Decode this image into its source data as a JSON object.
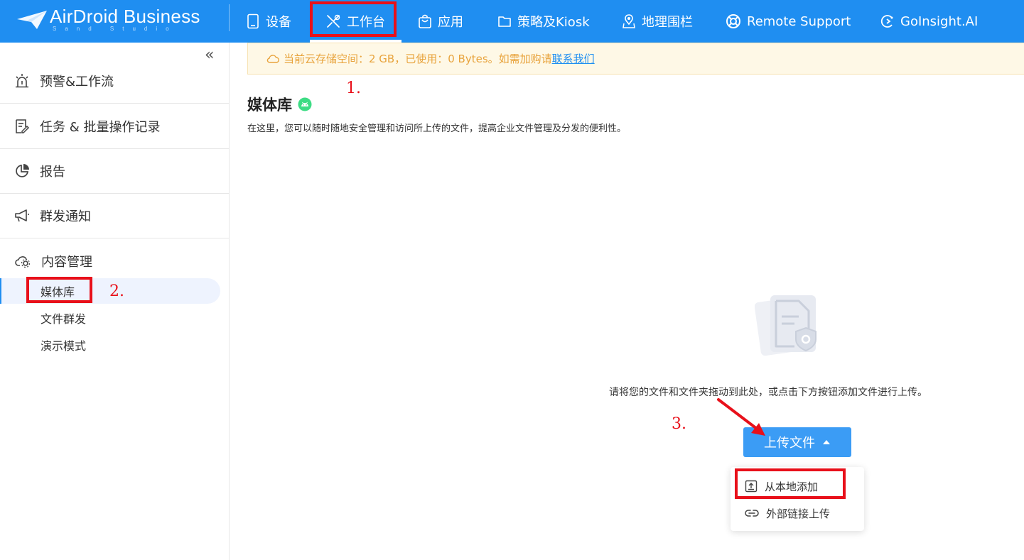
{
  "app": {
    "brand": "AirDroid Business",
    "brand_sub": "Sand Studio"
  },
  "nav": {
    "items": [
      {
        "label": "设备",
        "icon": "tablet-icon"
      },
      {
        "label": "工作台",
        "icon": "tools-icon",
        "active": true
      },
      {
        "label": "应用",
        "icon": "shopping-bag-icon"
      },
      {
        "label": "策略及Kiosk",
        "icon": "folder-icon"
      },
      {
        "label": "地理围栏",
        "icon": "map-pin-icon"
      },
      {
        "label": "Remote Support",
        "icon": "lifebuoy-icon"
      },
      {
        "label": "GoInsight.AI",
        "icon": "goinsight-icon"
      }
    ]
  },
  "sidebar": {
    "collapse_label": "«",
    "groups": [
      {
        "label": "预警&工作流",
        "icon": "alarm-icon"
      },
      {
        "label": "任务 & 批量操作记录",
        "icon": "task-list-icon"
      },
      {
        "label": "报告",
        "icon": "pie-chart-icon"
      },
      {
        "label": "群发通知",
        "icon": "megaphone-icon"
      },
      {
        "label": "内容管理",
        "icon": "cloud-settings-icon"
      }
    ],
    "sub_items": [
      {
        "label": "媒体库",
        "active": true
      },
      {
        "label": "文件群发"
      },
      {
        "label": "演示模式"
      }
    ]
  },
  "notice": {
    "text": "当前云存储空间：2 GB，已使用：0 Bytes。如需加购请",
    "link": "联系我们"
  },
  "main": {
    "title": "媒体库",
    "description": "在这里，您可以随时随地安全管理和访问所上传的文件，提高企业文件管理及分发的便利性。",
    "drop_hint": "请将您的文件和文件夹拖动到此处，或点击下方按钮添加文件进行上传。",
    "upload_button": "上传文件",
    "upload_menu": [
      {
        "label": "从本地添加",
        "icon": "upload-icon"
      },
      {
        "label": "外部链接上传",
        "icon": "link-icon"
      }
    ]
  },
  "annotations": {
    "step1": "1.",
    "step2": "2.",
    "step3": "3."
  },
  "colors": {
    "primary": "#1f8ef1",
    "button": "#3b9cf5",
    "notice_text": "#e8a33c",
    "notice_bg": "#fef8e6",
    "annotation_red": "#e8101a",
    "android_badge": "#3ddc84"
  }
}
